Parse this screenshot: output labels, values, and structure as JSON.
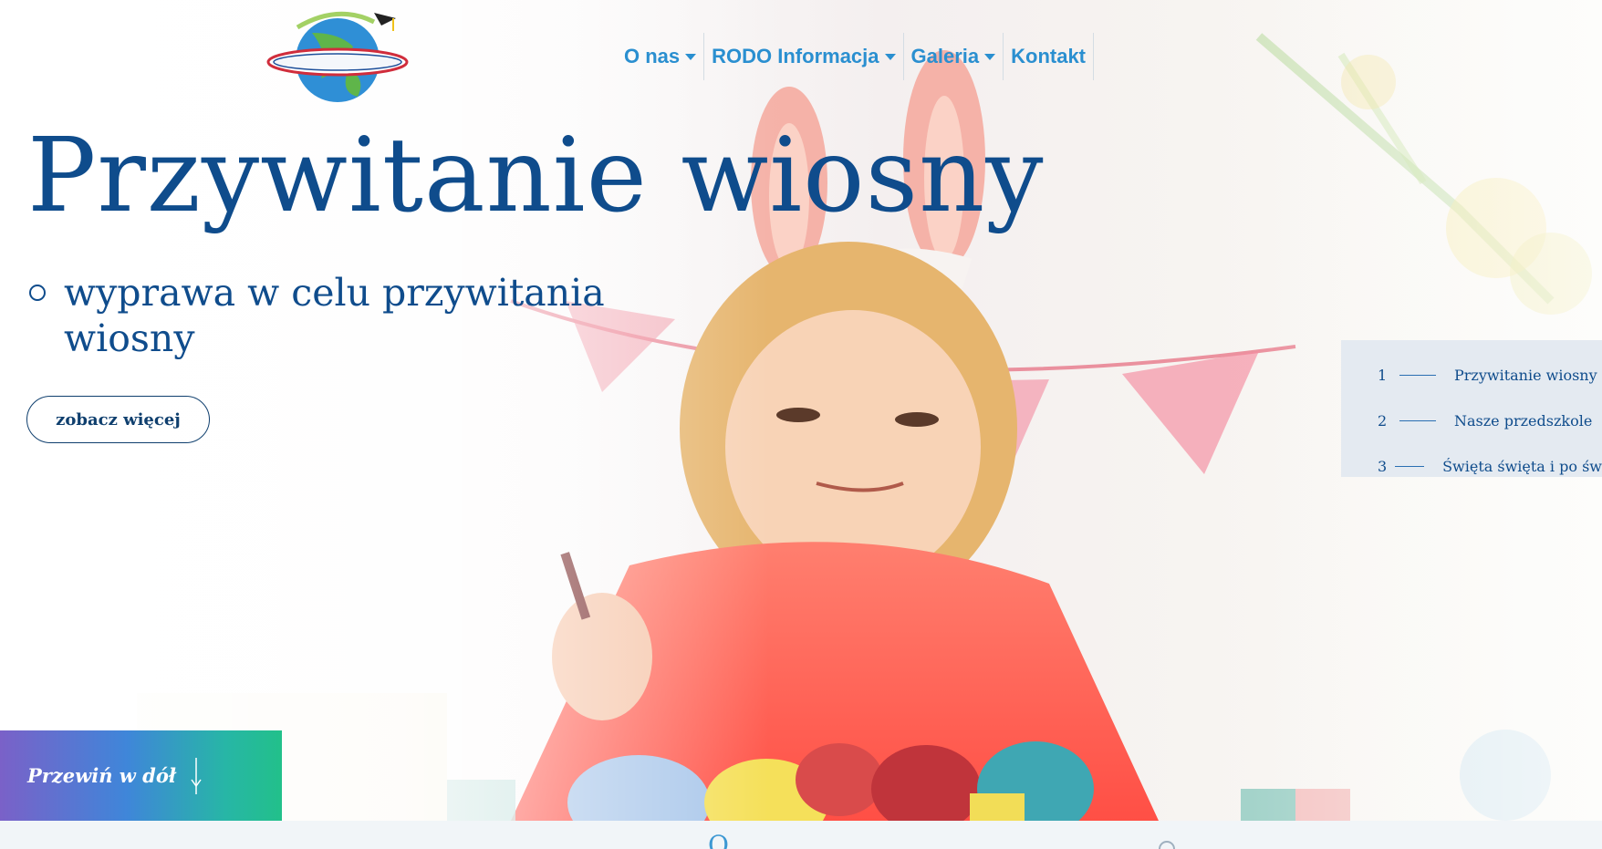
{
  "header": {
    "logo_alt": "Przedszkole Małego Kopernika",
    "nav": [
      {
        "label": "O nas",
        "has_dropdown": true
      },
      {
        "label": "RODO Informacja",
        "has_dropdown": true
      },
      {
        "label": "Galeria",
        "has_dropdown": true
      },
      {
        "label": "Kontakt",
        "has_dropdown": false
      }
    ]
  },
  "hero": {
    "title": "Przywitanie wiosny",
    "list_item": "wyprawa w celu przywitania wiosny",
    "button_label": "zobacz więcej"
  },
  "slides": [
    {
      "number": "1",
      "label": "Przywitanie wiosny"
    },
    {
      "number": "2",
      "label": "Nasze przedszkole"
    },
    {
      "number": "3",
      "label": "Święta święta i po św"
    }
  ],
  "scroll": {
    "label": "Przewiń w dół"
  },
  "below_fold": {
    "partial_text": "O "
  },
  "colors": {
    "primary": "#0f4c8c",
    "nav": "#2a8fd0",
    "scroll_gradient_start": "#7a61c8",
    "scroll_gradient_end": "#22c08a"
  }
}
